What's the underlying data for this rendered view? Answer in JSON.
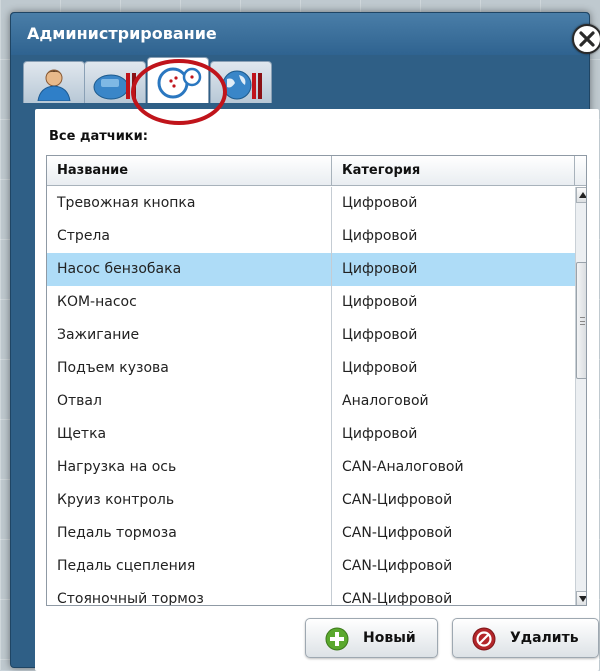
{
  "window": {
    "title": "Администрирование"
  },
  "tabs": [
    {
      "name": "users",
      "icon": "user-icon"
    },
    {
      "name": "vehicles",
      "icon": "vehicle-settings-icon"
    },
    {
      "name": "sensors",
      "icon": "gauge-icon",
      "active": true
    },
    {
      "name": "geozones",
      "icon": "globe-tools-icon"
    }
  ],
  "section": {
    "label": "Все датчики:"
  },
  "table": {
    "columns": [
      "Название",
      "Категория"
    ],
    "selected_index": 2,
    "rows": [
      {
        "name": "Тревожная кнопка",
        "category": "Цифровой"
      },
      {
        "name": "Стрела",
        "category": "Цифровой"
      },
      {
        "name": "Насос бензобака",
        "category": "Цифровой"
      },
      {
        "name": "КОМ-насос",
        "category": "Цифровой"
      },
      {
        "name": "Зажигание",
        "category": "Цифровой"
      },
      {
        "name": "Подъем кузова",
        "category": "Цифровой"
      },
      {
        "name": "Отвал",
        "category": "Аналоговой"
      },
      {
        "name": "Щетка",
        "category": "Цифровой"
      },
      {
        "name": "Нагрузка на ось",
        "category": "CAN-Аналоговой"
      },
      {
        "name": "Круиз контроль",
        "category": "CAN-Цифровой"
      },
      {
        "name": "Педаль тормоза",
        "category": "CAN-Цифровой"
      },
      {
        "name": "Педаль сцепления",
        "category": "CAN-Цифровой"
      },
      {
        "name": "Стояночный тормоз",
        "category": "CAN-Цифровой"
      }
    ]
  },
  "buttons": {
    "new_label": "Новый",
    "delete_label": "Удалить"
  },
  "colors": {
    "title_bar": "#2f6390",
    "selected_row": "#aedcf7",
    "highlight_ring": "#c0141b",
    "new_icon": "#5aa82d",
    "delete_icon": "#b3262a"
  }
}
